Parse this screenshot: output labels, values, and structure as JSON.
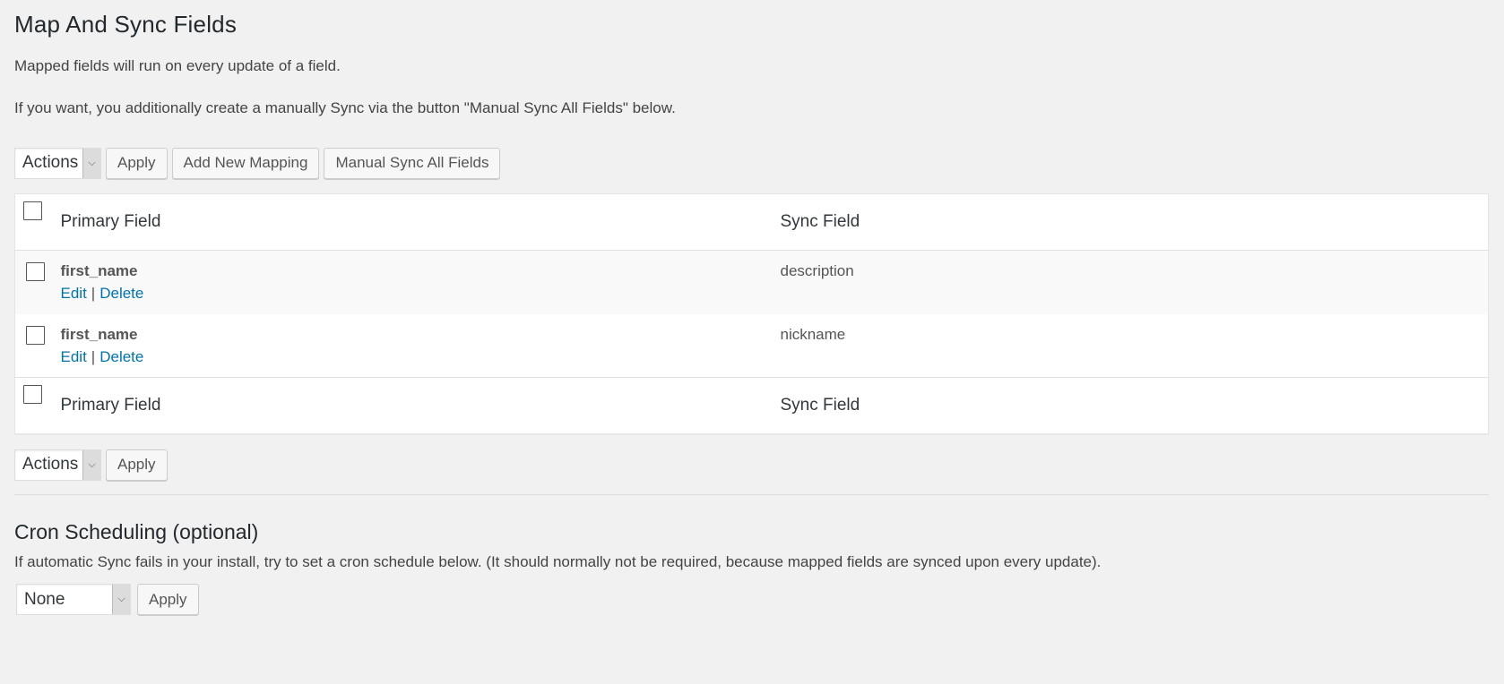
{
  "page": {
    "title": "Map And Sync Fields",
    "desc1": "Mapped fields will run on every update of a field.",
    "desc2": "If you want, you additionally create a manually Sync via the button \"Manual Sync All Fields\" below."
  },
  "toolbar_top": {
    "actions_label": "Actions",
    "apply_label": "Apply",
    "add_new_label": "Add New Mapping",
    "manual_sync_label": "Manual Sync All Fields"
  },
  "table": {
    "col_primary": "Primary Field",
    "col_sync": "Sync Field",
    "rows": [
      {
        "primary": "first_name",
        "sync": "description",
        "edit": "Edit",
        "sep": "|",
        "delete": "Delete"
      },
      {
        "primary": "first_name",
        "sync": "nickname",
        "edit": "Edit",
        "sep": "|",
        "delete": "Delete"
      }
    ]
  },
  "toolbar_bottom": {
    "actions_label": "Actions",
    "apply_label": "Apply"
  },
  "cron": {
    "heading": "Cron Scheduling (optional)",
    "note": "If automatic Sync fails in your install, try to set a cron schedule below. (It should normally not be required, because mapped fields are synced upon every update).",
    "select_value": "None",
    "apply_label": "Apply"
  },
  "icons": {
    "caret": "chevron-down-icon"
  },
  "colors": {
    "link": "#0073aa",
    "background": "#f1f1f1"
  }
}
